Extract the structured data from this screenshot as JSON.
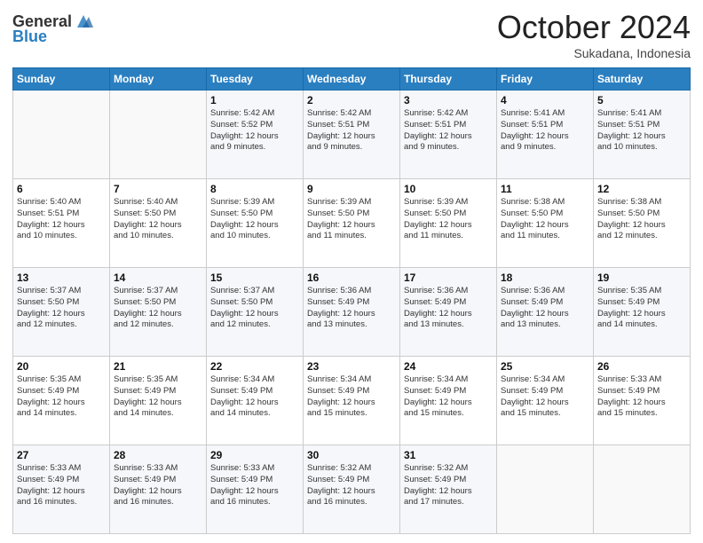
{
  "header": {
    "logo_general": "General",
    "logo_blue": "Blue",
    "month": "October 2024",
    "location": "Sukadana, Indonesia"
  },
  "weekdays": [
    "Sunday",
    "Monday",
    "Tuesday",
    "Wednesday",
    "Thursday",
    "Friday",
    "Saturday"
  ],
  "weeks": [
    [
      {
        "day": "",
        "info": ""
      },
      {
        "day": "",
        "info": ""
      },
      {
        "day": "1",
        "info": "Sunrise: 5:42 AM\nSunset: 5:52 PM\nDaylight: 12 hours\nand 9 minutes."
      },
      {
        "day": "2",
        "info": "Sunrise: 5:42 AM\nSunset: 5:51 PM\nDaylight: 12 hours\nand 9 minutes."
      },
      {
        "day": "3",
        "info": "Sunrise: 5:42 AM\nSunset: 5:51 PM\nDaylight: 12 hours\nand 9 minutes."
      },
      {
        "day": "4",
        "info": "Sunrise: 5:41 AM\nSunset: 5:51 PM\nDaylight: 12 hours\nand 9 minutes."
      },
      {
        "day": "5",
        "info": "Sunrise: 5:41 AM\nSunset: 5:51 PM\nDaylight: 12 hours\nand 10 minutes."
      }
    ],
    [
      {
        "day": "6",
        "info": "Sunrise: 5:40 AM\nSunset: 5:51 PM\nDaylight: 12 hours\nand 10 minutes."
      },
      {
        "day": "7",
        "info": "Sunrise: 5:40 AM\nSunset: 5:50 PM\nDaylight: 12 hours\nand 10 minutes."
      },
      {
        "day": "8",
        "info": "Sunrise: 5:39 AM\nSunset: 5:50 PM\nDaylight: 12 hours\nand 10 minutes."
      },
      {
        "day": "9",
        "info": "Sunrise: 5:39 AM\nSunset: 5:50 PM\nDaylight: 12 hours\nand 11 minutes."
      },
      {
        "day": "10",
        "info": "Sunrise: 5:39 AM\nSunset: 5:50 PM\nDaylight: 12 hours\nand 11 minutes."
      },
      {
        "day": "11",
        "info": "Sunrise: 5:38 AM\nSunset: 5:50 PM\nDaylight: 12 hours\nand 11 minutes."
      },
      {
        "day": "12",
        "info": "Sunrise: 5:38 AM\nSunset: 5:50 PM\nDaylight: 12 hours\nand 12 minutes."
      }
    ],
    [
      {
        "day": "13",
        "info": "Sunrise: 5:37 AM\nSunset: 5:50 PM\nDaylight: 12 hours\nand 12 minutes."
      },
      {
        "day": "14",
        "info": "Sunrise: 5:37 AM\nSunset: 5:50 PM\nDaylight: 12 hours\nand 12 minutes."
      },
      {
        "day": "15",
        "info": "Sunrise: 5:37 AM\nSunset: 5:50 PM\nDaylight: 12 hours\nand 12 minutes."
      },
      {
        "day": "16",
        "info": "Sunrise: 5:36 AM\nSunset: 5:49 PM\nDaylight: 12 hours\nand 13 minutes."
      },
      {
        "day": "17",
        "info": "Sunrise: 5:36 AM\nSunset: 5:49 PM\nDaylight: 12 hours\nand 13 minutes."
      },
      {
        "day": "18",
        "info": "Sunrise: 5:36 AM\nSunset: 5:49 PM\nDaylight: 12 hours\nand 13 minutes."
      },
      {
        "day": "19",
        "info": "Sunrise: 5:35 AM\nSunset: 5:49 PM\nDaylight: 12 hours\nand 14 minutes."
      }
    ],
    [
      {
        "day": "20",
        "info": "Sunrise: 5:35 AM\nSunset: 5:49 PM\nDaylight: 12 hours\nand 14 minutes."
      },
      {
        "day": "21",
        "info": "Sunrise: 5:35 AM\nSunset: 5:49 PM\nDaylight: 12 hours\nand 14 minutes."
      },
      {
        "day": "22",
        "info": "Sunrise: 5:34 AM\nSunset: 5:49 PM\nDaylight: 12 hours\nand 14 minutes."
      },
      {
        "day": "23",
        "info": "Sunrise: 5:34 AM\nSunset: 5:49 PM\nDaylight: 12 hours\nand 15 minutes."
      },
      {
        "day": "24",
        "info": "Sunrise: 5:34 AM\nSunset: 5:49 PM\nDaylight: 12 hours\nand 15 minutes."
      },
      {
        "day": "25",
        "info": "Sunrise: 5:34 AM\nSunset: 5:49 PM\nDaylight: 12 hours\nand 15 minutes."
      },
      {
        "day": "26",
        "info": "Sunrise: 5:33 AM\nSunset: 5:49 PM\nDaylight: 12 hours\nand 15 minutes."
      }
    ],
    [
      {
        "day": "27",
        "info": "Sunrise: 5:33 AM\nSunset: 5:49 PM\nDaylight: 12 hours\nand 16 minutes."
      },
      {
        "day": "28",
        "info": "Sunrise: 5:33 AM\nSunset: 5:49 PM\nDaylight: 12 hours\nand 16 minutes."
      },
      {
        "day": "29",
        "info": "Sunrise: 5:33 AM\nSunset: 5:49 PM\nDaylight: 12 hours\nand 16 minutes."
      },
      {
        "day": "30",
        "info": "Sunrise: 5:32 AM\nSunset: 5:49 PM\nDaylight: 12 hours\nand 16 minutes."
      },
      {
        "day": "31",
        "info": "Sunrise: 5:32 AM\nSunset: 5:49 PM\nDaylight: 12 hours\nand 17 minutes."
      },
      {
        "day": "",
        "info": ""
      },
      {
        "day": "",
        "info": ""
      }
    ]
  ]
}
